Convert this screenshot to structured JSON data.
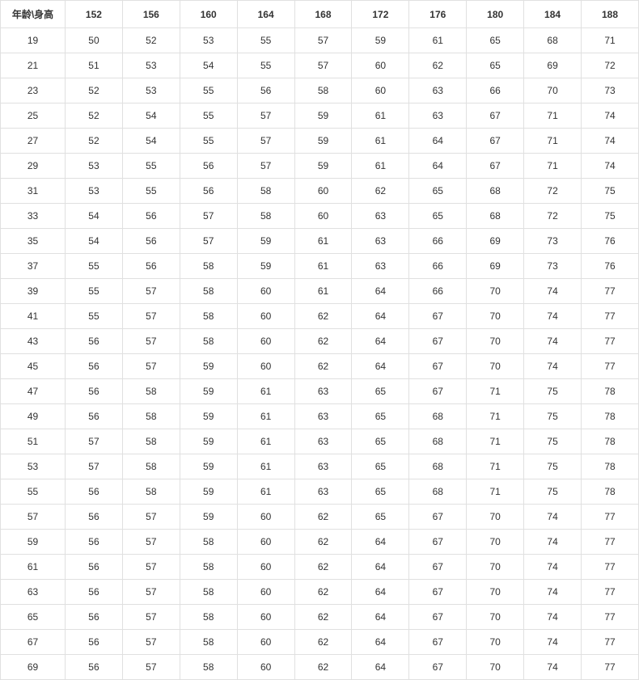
{
  "table": {
    "corner_label": "年龄\\身高",
    "column_headers": [
      "152",
      "156",
      "160",
      "164",
      "168",
      "172",
      "176",
      "180",
      "184",
      "188"
    ],
    "rows": [
      {
        "age": "19",
        "values": [
          "50",
          "52",
          "53",
          "55",
          "57",
          "59",
          "61",
          "65",
          "68",
          "71"
        ]
      },
      {
        "age": "21",
        "values": [
          "51",
          "53",
          "54",
          "55",
          "57",
          "60",
          "62",
          "65",
          "69",
          "72"
        ]
      },
      {
        "age": "23",
        "values": [
          "52",
          "53",
          "55",
          "56",
          "58",
          "60",
          "63",
          "66",
          "70",
          "73"
        ]
      },
      {
        "age": "25",
        "values": [
          "52",
          "54",
          "55",
          "57",
          "59",
          "61",
          "63",
          "67",
          "71",
          "74"
        ]
      },
      {
        "age": "27",
        "values": [
          "52",
          "54",
          "55",
          "57",
          "59",
          "61",
          "64",
          "67",
          "71",
          "74"
        ]
      },
      {
        "age": "29",
        "values": [
          "53",
          "55",
          "56",
          "57",
          "59",
          "61",
          "64",
          "67",
          "71",
          "74"
        ]
      },
      {
        "age": "31",
        "values": [
          "53",
          "55",
          "56",
          "58",
          "60",
          "62",
          "65",
          "68",
          "72",
          "75"
        ]
      },
      {
        "age": "33",
        "values": [
          "54",
          "56",
          "57",
          "58",
          "60",
          "63",
          "65",
          "68",
          "72",
          "75"
        ]
      },
      {
        "age": "35",
        "values": [
          "54",
          "56",
          "57",
          "59",
          "61",
          "63",
          "66",
          "69",
          "73",
          "76"
        ]
      },
      {
        "age": "37",
        "values": [
          "55",
          "56",
          "58",
          "59",
          "61",
          "63",
          "66",
          "69",
          "73",
          "76"
        ]
      },
      {
        "age": "39",
        "values": [
          "55",
          "57",
          "58",
          "60",
          "61",
          "64",
          "66",
          "70",
          "74",
          "77"
        ]
      },
      {
        "age": "41",
        "values": [
          "55",
          "57",
          "58",
          "60",
          "62",
          "64",
          "67",
          "70",
          "74",
          "77"
        ]
      },
      {
        "age": "43",
        "values": [
          "56",
          "57",
          "58",
          "60",
          "62",
          "64",
          "67",
          "70",
          "74",
          "77"
        ]
      },
      {
        "age": "45",
        "values": [
          "56",
          "57",
          "59",
          "60",
          "62",
          "64",
          "67",
          "70",
          "74",
          "77"
        ]
      },
      {
        "age": "47",
        "values": [
          "56",
          "58",
          "59",
          "61",
          "63",
          "65",
          "67",
          "71",
          "75",
          "78"
        ]
      },
      {
        "age": "49",
        "values": [
          "56",
          "58",
          "59",
          "61",
          "63",
          "65",
          "68",
          "71",
          "75",
          "78"
        ]
      },
      {
        "age": "51",
        "values": [
          "57",
          "58",
          "59",
          "61",
          "63",
          "65",
          "68",
          "71",
          "75",
          "78"
        ]
      },
      {
        "age": "53",
        "values": [
          "57",
          "58",
          "59",
          "61",
          "63",
          "65",
          "68",
          "71",
          "75",
          "78"
        ]
      },
      {
        "age": "55",
        "values": [
          "56",
          "58",
          "59",
          "61",
          "63",
          "65",
          "68",
          "71",
          "75",
          "78"
        ]
      },
      {
        "age": "57",
        "values": [
          "56",
          "57",
          "59",
          "60",
          "62",
          "65",
          "67",
          "70",
          "74",
          "77"
        ]
      },
      {
        "age": "59",
        "values": [
          "56",
          "57",
          "58",
          "60",
          "62",
          "64",
          "67",
          "70",
          "74",
          "77"
        ]
      },
      {
        "age": "61",
        "values": [
          "56",
          "57",
          "58",
          "60",
          "62",
          "64",
          "67",
          "70",
          "74",
          "77"
        ]
      },
      {
        "age": "63",
        "values": [
          "56",
          "57",
          "58",
          "60",
          "62",
          "64",
          "67",
          "70",
          "74",
          "77"
        ]
      },
      {
        "age": "65",
        "values": [
          "56",
          "57",
          "58",
          "60",
          "62",
          "64",
          "67",
          "70",
          "74",
          "77"
        ]
      },
      {
        "age": "67",
        "values": [
          "56",
          "57",
          "58",
          "60",
          "62",
          "64",
          "67",
          "70",
          "74",
          "77"
        ]
      },
      {
        "age": "69",
        "values": [
          "56",
          "57",
          "58",
          "60",
          "62",
          "64",
          "67",
          "70",
          "74",
          "77"
        ]
      }
    ]
  }
}
